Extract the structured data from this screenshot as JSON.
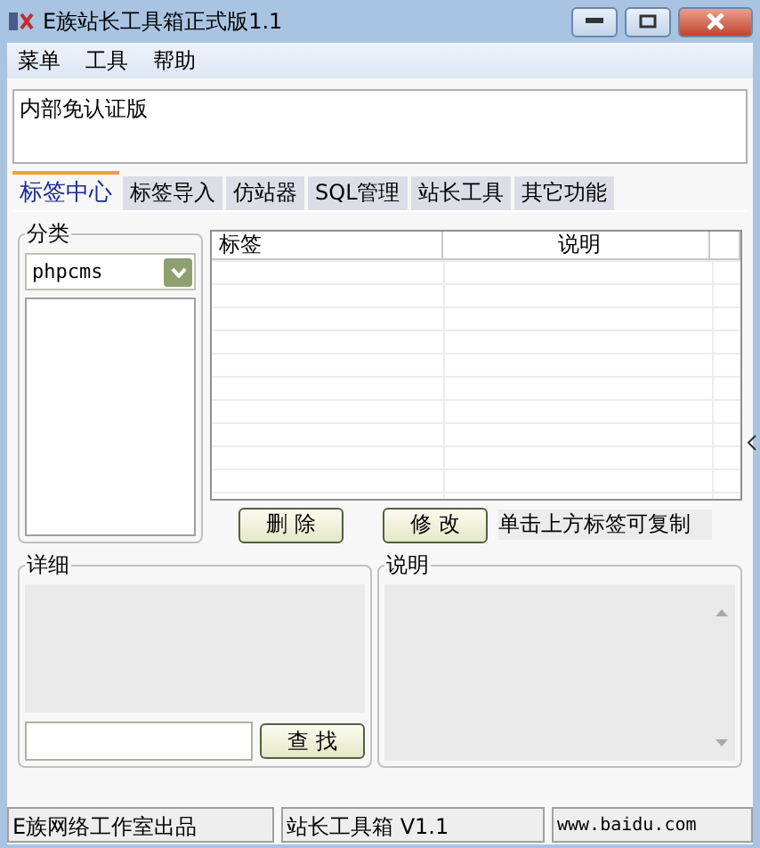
{
  "window": {
    "title": "E族站长工具箱正式版1.1"
  },
  "menu": [
    "菜单",
    "工具",
    "帮助"
  ],
  "notice": "内部免认证版",
  "tabs": [
    {
      "label": "标签中心",
      "selected": true
    },
    {
      "label": "标签导入",
      "selected": false
    },
    {
      "label": "仿站器",
      "selected": false
    },
    {
      "label": "SQL管理",
      "selected": false
    },
    {
      "label": "站长工具",
      "selected": false
    },
    {
      "label": "其它功能",
      "selected": false
    }
  ],
  "category": {
    "title": "分类",
    "value": "phpcms"
  },
  "table": {
    "columns": [
      "标签",
      "说明"
    ]
  },
  "buttons": [
    "删 除",
    "修 改"
  ],
  "hint": "单击上方标签可复制",
  "detail": {
    "title": "详细",
    "search_button": "查 找"
  },
  "description": {
    "title": "说明"
  },
  "status_bar": [
    "E族网络工作室出品",
    "站长工具箱 V1.1",
    "www.baidu.com"
  ]
}
